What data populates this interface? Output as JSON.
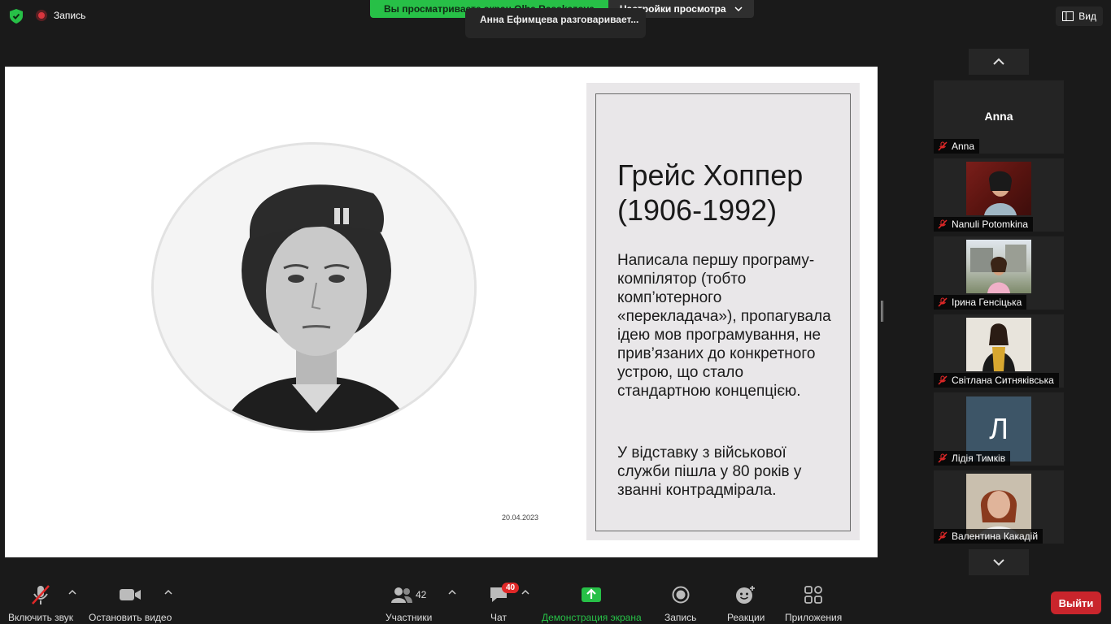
{
  "top_bar": {
    "recording_label": "Запись",
    "viewing_label": "Вы просматриваете экран Olha Rasskazova",
    "view_options_label": "Настройки просмотра",
    "speaker_toast": "Анна Ефимцева разговаривает...",
    "view_label": "Вид"
  },
  "slide": {
    "title_line1": "Грейс Хоппер",
    "title_line2": "(1906-1992)",
    "paragraph1": "Написала першу програму-компілятор (тобто   комп’ютерного «перекладача»), пропагувала ідею мов програмування, не прив’язаних до конкретного устрою, що стало стандартною концепцією.",
    "paragraph2": "У відставку з військової служби  пішла у 80 років у званні контрадмірала.",
    "date": "20.04.2023"
  },
  "gallery": {
    "participants": [
      {
        "name": "Anna",
        "display": "Anna",
        "muted": true,
        "type": "text"
      },
      {
        "name": "Nanuli Potomkina",
        "muted": true,
        "type": "photo"
      },
      {
        "name": "Ірина Генсіцька",
        "muted": true,
        "type": "photo"
      },
      {
        "name": "Світлана Ситняківська",
        "muted": true,
        "type": "photo"
      },
      {
        "name": "Лідія Тимків",
        "initial": "Л",
        "muted": true,
        "type": "initial"
      },
      {
        "name": "Валентина Какадій",
        "muted": true,
        "type": "photo"
      }
    ]
  },
  "toolbar": {
    "unmute_label": "Включить звук",
    "stop_video_label": "Остановить видео",
    "participants_label": "Участники",
    "participants_count": "42",
    "chat_label": "Чат",
    "chat_badge": "40",
    "share_label": "Демонстрация экрана",
    "record_label": "Запись",
    "reactions_label": "Реакции",
    "apps_label": "Приложения",
    "leave_label": "Выйти"
  },
  "colors": {
    "accent_green": "#27c047",
    "leave_red": "#c9252c",
    "background": "#1a1a1a"
  }
}
